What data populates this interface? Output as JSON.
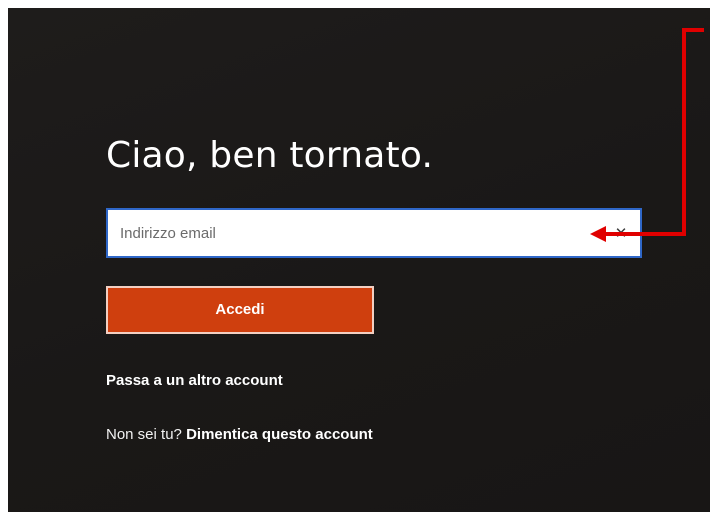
{
  "page": {
    "greeting": "Ciao, ben tornato."
  },
  "email": {
    "placeholder": "Indirizzo email",
    "value": "",
    "clear_icon": "close-icon",
    "clear_glyph": "✕"
  },
  "signin": {
    "label": "Accedi"
  },
  "links": {
    "switch_account": "Passa a un altro account",
    "not_you_prefix": "Non sei tu?",
    "forget_account": "Dimentica questo account"
  },
  "colors": {
    "background": "#1c1a19",
    "input_border": "#2f67c8",
    "signin_button": "#cf3f0e",
    "annotation_arrow": "#e00000"
  }
}
